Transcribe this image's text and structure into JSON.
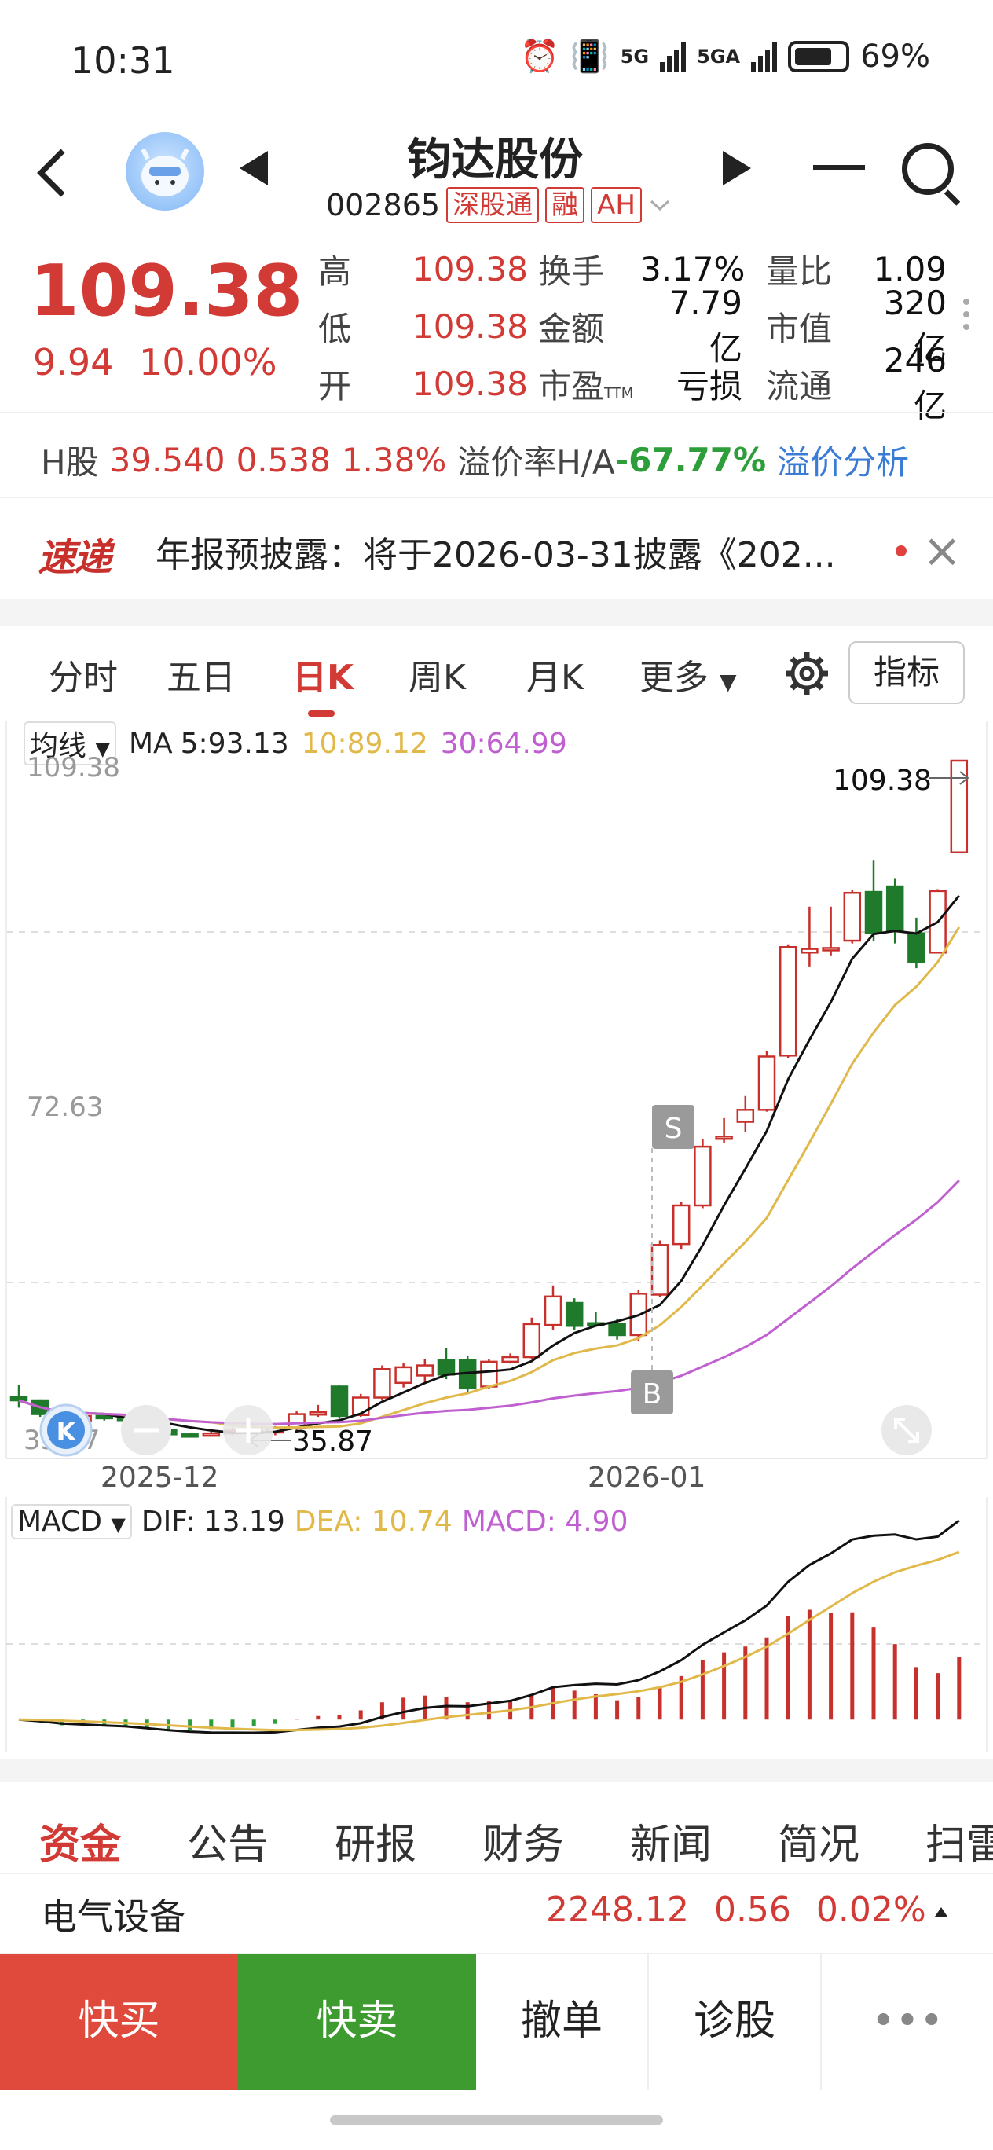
{
  "status": {
    "time": "10:31",
    "net1": "5G",
    "net2": "5GA",
    "battery": "69%"
  },
  "header": {
    "name": "钧达股份",
    "code": "002865",
    "tags": [
      "深股通",
      "融",
      "AH"
    ]
  },
  "quote": {
    "price": "109.38",
    "change": "9.94",
    "change_pct": "10.00%",
    "rows": [
      {
        "l1": "高",
        "v1": "109.38",
        "l2": "换手",
        "v2": "3.17%",
        "l3": "量比",
        "v3": "1.09"
      },
      {
        "l1": "低",
        "v1": "109.38",
        "l2": "金额",
        "v2": "7.79亿",
        "l3": "市值",
        "v3": "320亿"
      },
      {
        "l1": "开",
        "v1": "109.38",
        "l2": "市盈",
        "l2sub": "TTM",
        "v2": "亏损",
        "l3": "流通",
        "v3": "246亿"
      }
    ]
  },
  "hshare": {
    "label": "H股",
    "price": "39.540",
    "change": "0.538",
    "pct": "1.38%",
    "premium_label": "溢价率H/A",
    "premium": "-67.77%",
    "link": "溢价分析"
  },
  "news": {
    "logo": "速递",
    "text": "年报预披露：将于2026-03-31披露《202..."
  },
  "period_tabs": [
    "分时",
    "五日",
    "日K",
    "周K",
    "月K",
    "更多"
  ],
  "indicator_btn": "指标",
  "ma_legend": {
    "toggle": "均线",
    "ma": "MA",
    "ma5": "5:93.13",
    "ma10": "10:89.12",
    "ma30": "30:64.99",
    "colors": {
      "ma5": "#111111",
      "ma10": "#e0b94a",
      "ma30": "#c060d0"
    }
  },
  "chart_data": [
    {
      "type": "candlestick",
      "title": "",
      "y_labels": [
        "109.38",
        "72.63",
        "35.87"
      ],
      "ylim": [
        35.87,
        109.38
      ],
      "x_ticks": [
        "2025-12",
        "2026-01"
      ],
      "last_price_label": "109.38",
      "low_marker_label": "35.87",
      "signals": [
        "S",
        "B"
      ],
      "candles": [
        [
          40.2,
          41.5,
          39.0,
          39.8
        ],
        [
          39.8,
          39.9,
          38.0,
          38.3
        ],
        [
          38.3,
          38.7,
          37.1,
          37.5
        ],
        [
          37.5,
          38.4,
          37.3,
          38.1
        ],
        [
          38.1,
          38.3,
          37.6,
          37.9
        ],
        [
          37.9,
          38.2,
          37.3,
          37.7
        ],
        [
          37.7,
          37.8,
          36.5,
          36.6
        ],
        [
          36.6,
          36.9,
          35.9,
          36.1
        ],
        [
          36.1,
          36.3,
          35.9,
          36.0
        ],
        [
          36.0,
          36.4,
          35.87,
          36.2
        ],
        [
          36.2,
          36.8,
          36.0,
          36.5
        ],
        [
          36.5,
          37.1,
          36.2,
          36.4
        ],
        [
          36.3,
          37.0,
          36.0,
          36.8
        ],
        [
          36.8,
          38.6,
          36.5,
          38.3
        ],
        [
          38.3,
          39.3,
          38.0,
          38.5
        ],
        [
          41.3,
          41.5,
          37.8,
          38.1
        ],
        [
          38.2,
          40.5,
          38.0,
          40.1
        ],
        [
          40.1,
          43.6,
          39.8,
          43.2
        ],
        [
          41.7,
          43.9,
          41.2,
          43.4
        ],
        [
          42.5,
          44.3,
          41.8,
          43.6
        ],
        [
          44.2,
          45.5,
          42.1,
          42.6
        ],
        [
          44.2,
          44.6,
          40.6,
          41.1
        ],
        [
          41.3,
          44.3,
          41.0,
          44.0
        ],
        [
          44.0,
          44.9,
          43.8,
          44.5
        ],
        [
          44.5,
          48.8,
          44.3,
          48.1
        ],
        [
          48.0,
          52.3,
          47.5,
          51.1
        ],
        [
          50.4,
          50.9,
          47.5,
          47.9
        ],
        [
          48.2,
          49.4,
          47.8,
          48.0
        ],
        [
          48.1,
          48.7,
          46.4,
          46.9
        ],
        [
          46.9,
          51.8,
          46.2,
          51.4
        ],
        [
          51.3,
          57.2,
          51.0,
          56.7
        ],
        [
          56.8,
          61.4,
          56.2,
          61.0
        ],
        [
          61.0,
          68.2,
          60.7,
          67.4
        ],
        [
          68.4,
          70.5,
          67.8,
          68.5
        ],
        [
          70.1,
          72.9,
          69.0,
          71.4
        ],
        [
          71.4,
          77.8,
          71.2,
          77.2
        ],
        [
          77.3,
          89.4,
          77.0,
          89.1
        ],
        [
          88.5,
          93.5,
          87.0,
          88.9
        ],
        [
          89.0,
          93.5,
          88.2,
          89.0
        ],
        [
          89.8,
          95.3,
          89.5,
          95.0
        ],
        [
          95.1,
          98.5,
          89.8,
          90.6
        ],
        [
          95.7,
          96.6,
          89.5,
          90.8
        ],
        [
          90.6,
          92.3,
          86.8,
          87.5
        ],
        [
          88.5,
          95.4,
          88.5,
          95.2
        ],
        [
          99.4,
          109.38,
          99.4,
          109.38
        ]
      ]
    },
    {
      "type": "macd",
      "title": "",
      "toggle": "MACD",
      "dif_label": "DIF: 13.19",
      "dea_label": "DEA: 10.74",
      "macd_label": "MACD: 4.90",
      "colors": {
        "dif": "#111111",
        "dea": "#e0b94a",
        "macd": "#c060d0",
        "bar_up": "#c8302b",
        "bar_down": "#2e9e3a"
      }
    }
  ],
  "info_tabs": [
    "资金",
    "公告",
    "研报",
    "财务",
    "新闻",
    "简况",
    "扫雷"
  ],
  "sector": {
    "name": "电气设备",
    "value": "2248.12",
    "change": "0.56",
    "pct": "0.02%"
  },
  "bottom": {
    "buy": "快买",
    "sell": "快卖",
    "cancel": "撤单",
    "diag": "诊股",
    "more": "•••"
  }
}
